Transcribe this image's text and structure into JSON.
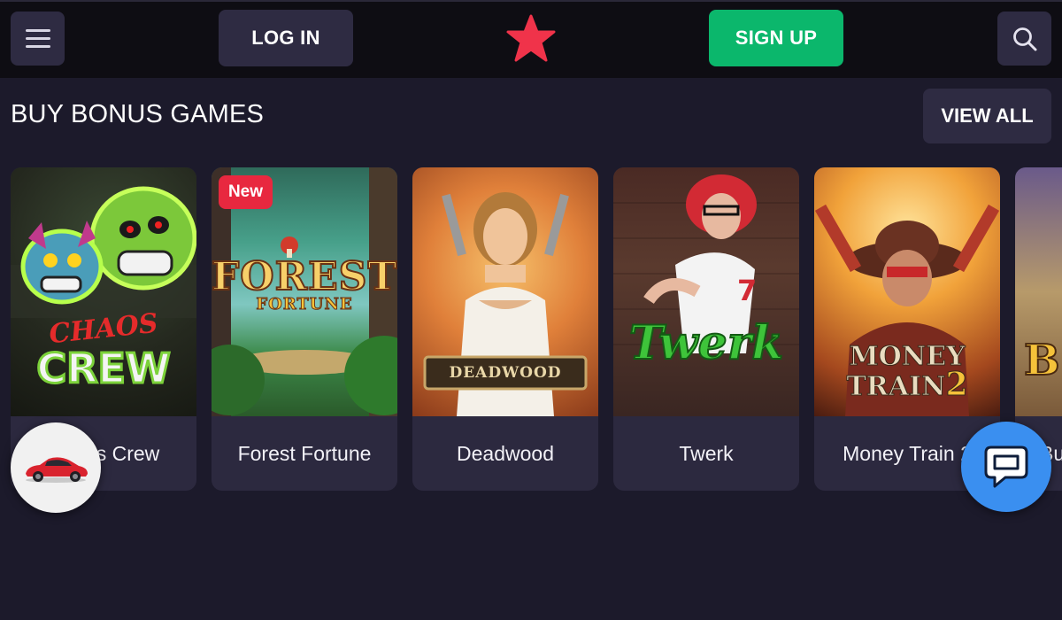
{
  "header": {
    "menu_icon": "hamburger-menu-icon",
    "login_label": "LOG IN",
    "logo_icon": "star-logo-icon",
    "signup_label": "SIGN UP",
    "search_icon": "search-icon",
    "colors": {
      "signup": "#0bb76c",
      "logo": "#f0334a",
      "button": "#2e2b42"
    }
  },
  "section": {
    "title": "BUY BONUS GAMES",
    "view_all_label": "VIEW ALL"
  },
  "games": [
    {
      "name": "Chaos Crew",
      "thumb_text": [
        "CHAOS",
        "CREW"
      ],
      "badge": ""
    },
    {
      "name": "Forest Fortune",
      "thumb_text": [
        "FOREST",
        "FORTUNE"
      ],
      "badge": "New"
    },
    {
      "name": "Deadwood",
      "thumb_text": [
        "DEADWOOD"
      ],
      "badge": ""
    },
    {
      "name": "Twerk",
      "thumb_text": [
        "Twerk"
      ],
      "badge": ""
    },
    {
      "name": "Money Train 2",
      "thumb_text": [
        "MONEY",
        "TRAIN",
        "2"
      ],
      "badge": ""
    },
    {
      "name": "Bu",
      "thumb_text": [
        "B"
      ],
      "badge": ""
    }
  ],
  "widgets": {
    "promo_icon": "red-car-icon",
    "chat_icon": "chat-bubble-icon"
  }
}
